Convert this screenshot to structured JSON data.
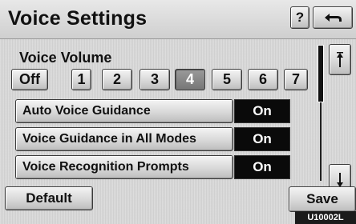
{
  "header": {
    "title": "Voice Settings",
    "help_label": "?",
    "back_icon": "back-arrow-icon"
  },
  "volume": {
    "label": "Voice Volume",
    "options": [
      "Off",
      "1",
      "2",
      "3",
      "4",
      "5",
      "6",
      "7"
    ],
    "selected": "4"
  },
  "settings": [
    {
      "label": "Auto Voice Guidance",
      "value": "On"
    },
    {
      "label": "Voice Guidance in All Modes",
      "value": "On"
    },
    {
      "label": "Voice Recognition Prompts",
      "value": "On"
    }
  ],
  "scroll": {
    "up_icon": "scroll-up-icon",
    "down_icon": "scroll-down-icon"
  },
  "footer": {
    "default_label": "Default",
    "save_label": "Save",
    "code": "U10002L"
  }
}
